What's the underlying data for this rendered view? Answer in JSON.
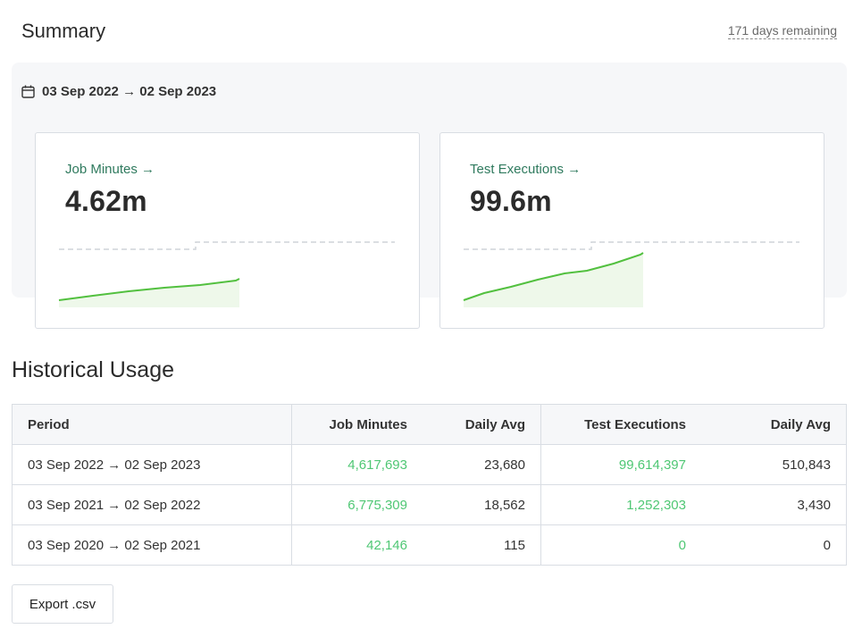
{
  "header": {
    "title": "Summary",
    "days_remaining": "171 days remaining"
  },
  "summary": {
    "date_range": "03 Sep 2022 → 02 Sep 2023",
    "cards": [
      {
        "label": "Job Minutes →",
        "value": "4.62m",
        "line_color": "#52c03f"
      },
      {
        "label": "Test Executions →",
        "value": "99.6m",
        "line_color": "#52c03f"
      }
    ]
  },
  "historical": {
    "title": "Historical Usage",
    "columns": [
      "Period",
      "Job Minutes",
      "Daily Avg",
      "Test Executions",
      "Daily Avg"
    ],
    "rows": [
      [
        "03 Sep 2022 → 02 Sep 2023",
        "4,617,693",
        "23,680",
        "99,614,397",
        "510,843"
      ],
      [
        "03 Sep 2021 → 02 Sep 2022",
        "6,775,309",
        "18,562",
        "1,252,303",
        "3,430"
      ],
      [
        "03 Sep 2020 → 02 Sep 2021",
        "42,146",
        "115",
        "0",
        "0"
      ]
    ]
  },
  "export_label": "Export .csv",
  "colors": {
    "accent_link": "#2f7a5e",
    "positive_value": "#4fc774",
    "panel_bg": "#f6f7f9"
  }
}
